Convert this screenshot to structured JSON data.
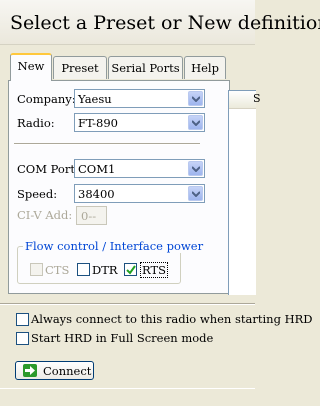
{
  "window": {
    "title": "Select a Preset or New definition"
  },
  "tabs": [
    {
      "label": "New",
      "active": true
    },
    {
      "label": "Preset",
      "active": false
    },
    {
      "label": "Serial Ports",
      "active": false
    },
    {
      "label": "Help",
      "active": false
    }
  ],
  "form": {
    "company_label": "Company:",
    "company_value": "Yaesu",
    "radio_label": "Radio:",
    "radio_value": "FT-890",
    "com_port_label": "COM Port:",
    "com_port_value": "COM1",
    "speed_label": "Speed:",
    "speed_value": "38400",
    "civ_label": "CI-V Add:",
    "civ_value": "0--"
  },
  "flow_control": {
    "legend": "Flow control / Interface power",
    "cts": {
      "label": "CTS",
      "checked": false,
      "enabled": false
    },
    "dtr": {
      "label": "DTR",
      "checked": false,
      "enabled": true
    },
    "rts": {
      "label": "RTS",
      "checked": true,
      "enabled": true
    }
  },
  "options": {
    "always_connect": "Always connect to this radio when starting HRD",
    "full_screen": "Start HRD in Full Screen mode"
  },
  "connect_button": "Connect",
  "right_list_header": "S",
  "colors": {
    "accent_tab": "#ffc83c",
    "group_legend": "#0046d5",
    "connect_icon": "#2c9a2c"
  },
  "icons": [
    "dropdown-arrow-icon",
    "checkmark-icon",
    "connect-arrow-icon"
  ]
}
